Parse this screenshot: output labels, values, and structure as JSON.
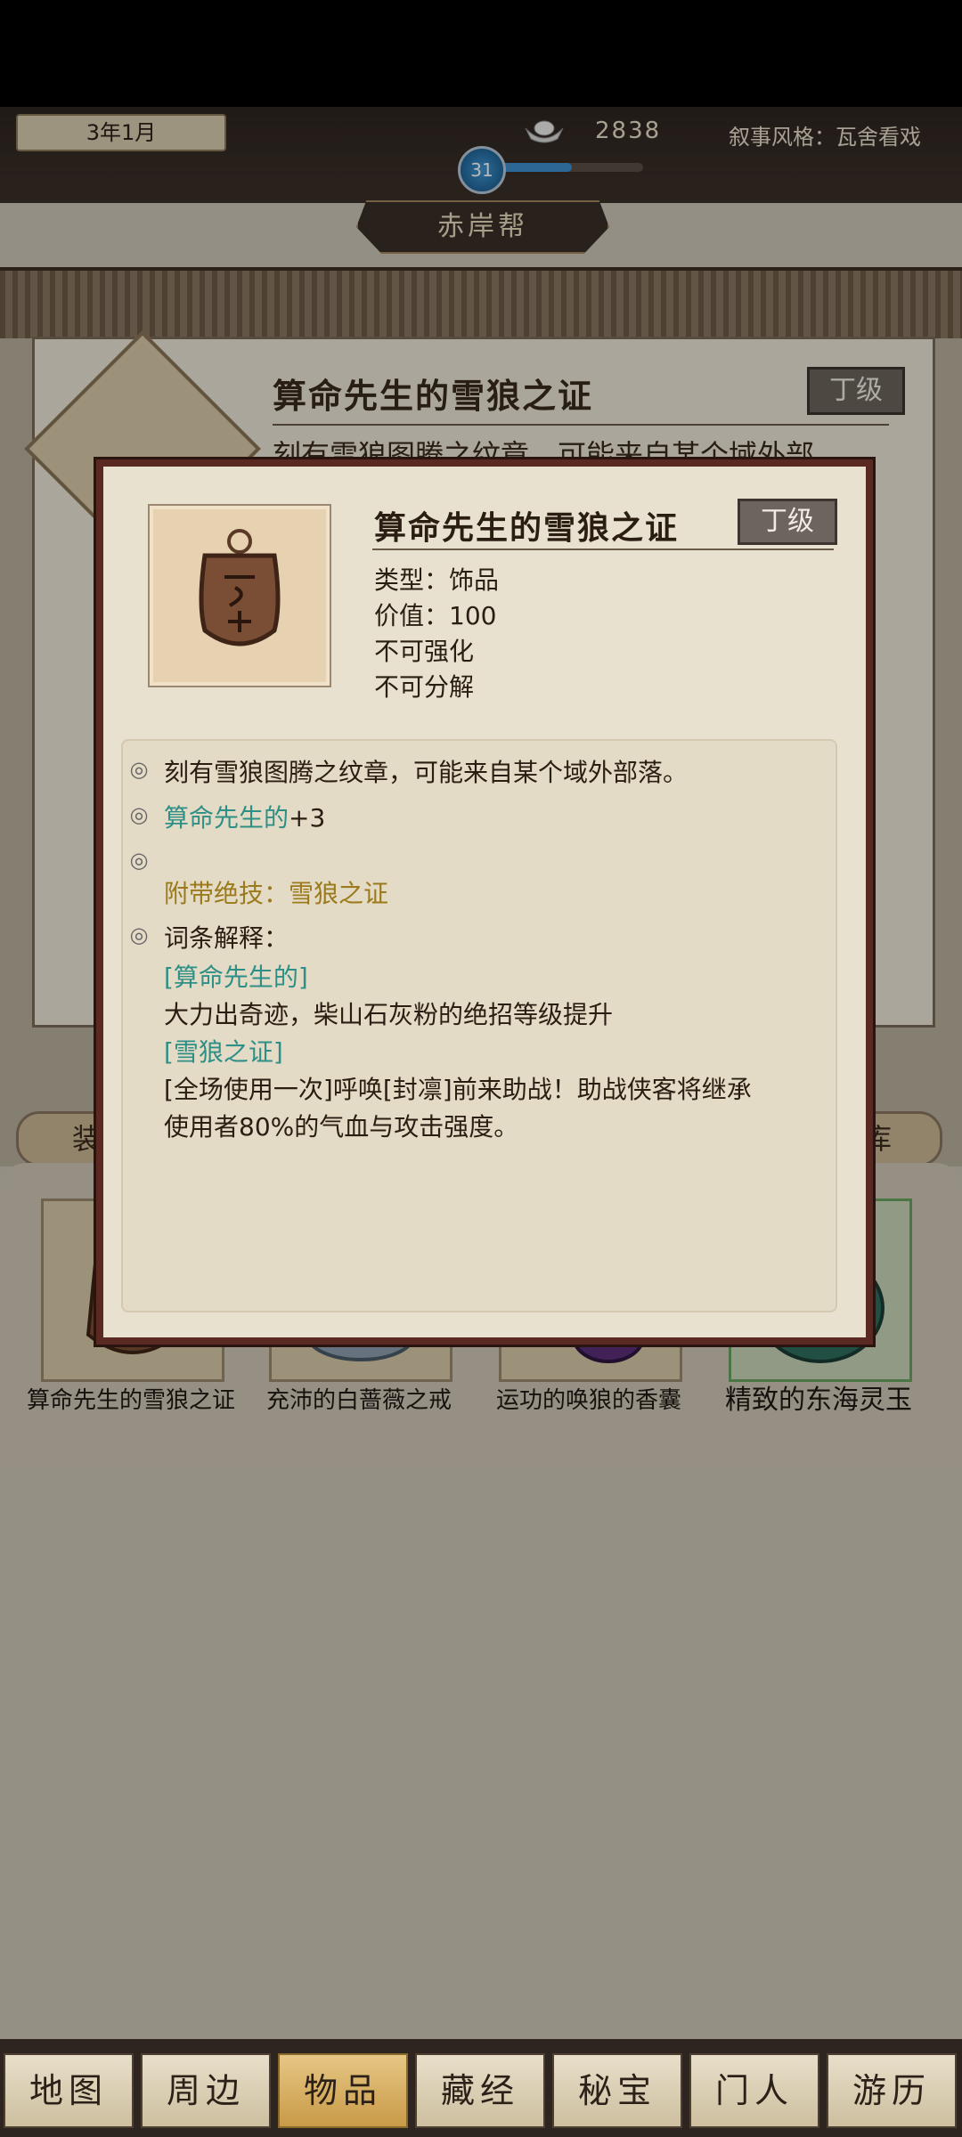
{
  "status_bar": {
    "date": "3年1月",
    "silver_amount": "2838",
    "narrative_style": "叙事风格：瓦舍看戏",
    "level": "31",
    "sect_name": "赤岸帮"
  },
  "background_detail": {
    "title": "算命先生的雪狼之证",
    "grade": "丁级",
    "desc_partial": "刻有雪狼图腾之纹章，可能来自某个域外部"
  },
  "tabs": {
    "equip_partial": "装",
    "store_partial": "库"
  },
  "items": [
    {
      "name": "算命先生的雪狼之证"
    },
    {
      "name": "充沛的白蔷薇之戒"
    },
    {
      "name": "运功的唤狼的香囊"
    },
    {
      "name": "精致的东海灵玉"
    }
  ],
  "popup": {
    "title": "算命先生的雪狼之证",
    "grade": "丁级",
    "attributes": {
      "type": "类型：饰品",
      "value": "价值：100",
      "enhance": "不可强化",
      "decompose": "不可分解"
    },
    "description": {
      "line1": "刻有雪狼图腾之纹章，可能来自某个域外部落。",
      "bonus_name": "算命先生的",
      "bonus_value": "+3",
      "skill": "附带绝技：雪狼之证",
      "glossary_label": "词条解释：",
      "term1_name": "[算命先生的]",
      "term1_desc": "大力出奇迹，柴山石灰粉的绝招等级提升",
      "term2_name": "[雪狼之证]",
      "term2_desc_line1": "[全场使用一次]呼唤[封凛]前来助战！助战侠客将继承",
      "term2_desc_line2": "使用者80%的气血与攻击强度。"
    }
  },
  "bottom_nav": [
    {
      "label": "地图"
    },
    {
      "label": "周边"
    },
    {
      "label": "物品",
      "active": true
    },
    {
      "label": "藏经"
    },
    {
      "label": "秘宝"
    },
    {
      "label": "门人"
    },
    {
      "label": "游历"
    }
  ],
  "colors": {
    "popup_border": "#5a2a22",
    "teal_text": "#2e8f86",
    "gold_text": "#9b7a1c",
    "nav_active": "#c99a48",
    "level_fill": "#3d8fd0"
  },
  "level_progress": 0.5
}
